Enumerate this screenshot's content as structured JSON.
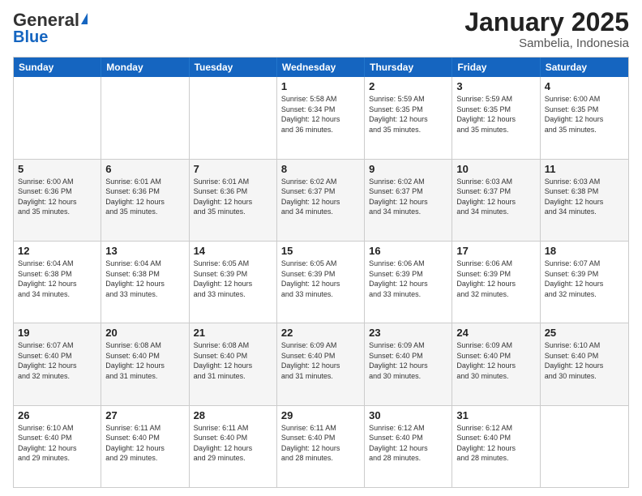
{
  "header": {
    "logo_general": "General",
    "logo_blue": "Blue",
    "month_title": "January 2025",
    "subtitle": "Sambelia, Indonesia"
  },
  "days_of_week": [
    "Sunday",
    "Monday",
    "Tuesday",
    "Wednesday",
    "Thursday",
    "Friday",
    "Saturday"
  ],
  "rows": [
    {
      "alt": false,
      "cells": [
        {
          "day": "",
          "info": ""
        },
        {
          "day": "",
          "info": ""
        },
        {
          "day": "",
          "info": ""
        },
        {
          "day": "1",
          "info": "Sunrise: 5:58 AM\nSunset: 6:34 PM\nDaylight: 12 hours\nand 36 minutes."
        },
        {
          "day": "2",
          "info": "Sunrise: 5:59 AM\nSunset: 6:35 PM\nDaylight: 12 hours\nand 35 minutes."
        },
        {
          "day": "3",
          "info": "Sunrise: 5:59 AM\nSunset: 6:35 PM\nDaylight: 12 hours\nand 35 minutes."
        },
        {
          "day": "4",
          "info": "Sunrise: 6:00 AM\nSunset: 6:35 PM\nDaylight: 12 hours\nand 35 minutes."
        }
      ]
    },
    {
      "alt": true,
      "cells": [
        {
          "day": "5",
          "info": "Sunrise: 6:00 AM\nSunset: 6:36 PM\nDaylight: 12 hours\nand 35 minutes."
        },
        {
          "day": "6",
          "info": "Sunrise: 6:01 AM\nSunset: 6:36 PM\nDaylight: 12 hours\nand 35 minutes."
        },
        {
          "day": "7",
          "info": "Sunrise: 6:01 AM\nSunset: 6:36 PM\nDaylight: 12 hours\nand 35 minutes."
        },
        {
          "day": "8",
          "info": "Sunrise: 6:02 AM\nSunset: 6:37 PM\nDaylight: 12 hours\nand 34 minutes."
        },
        {
          "day": "9",
          "info": "Sunrise: 6:02 AM\nSunset: 6:37 PM\nDaylight: 12 hours\nand 34 minutes."
        },
        {
          "day": "10",
          "info": "Sunrise: 6:03 AM\nSunset: 6:37 PM\nDaylight: 12 hours\nand 34 minutes."
        },
        {
          "day": "11",
          "info": "Sunrise: 6:03 AM\nSunset: 6:38 PM\nDaylight: 12 hours\nand 34 minutes."
        }
      ]
    },
    {
      "alt": false,
      "cells": [
        {
          "day": "12",
          "info": "Sunrise: 6:04 AM\nSunset: 6:38 PM\nDaylight: 12 hours\nand 34 minutes."
        },
        {
          "day": "13",
          "info": "Sunrise: 6:04 AM\nSunset: 6:38 PM\nDaylight: 12 hours\nand 33 minutes."
        },
        {
          "day": "14",
          "info": "Sunrise: 6:05 AM\nSunset: 6:39 PM\nDaylight: 12 hours\nand 33 minutes."
        },
        {
          "day": "15",
          "info": "Sunrise: 6:05 AM\nSunset: 6:39 PM\nDaylight: 12 hours\nand 33 minutes."
        },
        {
          "day": "16",
          "info": "Sunrise: 6:06 AM\nSunset: 6:39 PM\nDaylight: 12 hours\nand 33 minutes."
        },
        {
          "day": "17",
          "info": "Sunrise: 6:06 AM\nSunset: 6:39 PM\nDaylight: 12 hours\nand 32 minutes."
        },
        {
          "day": "18",
          "info": "Sunrise: 6:07 AM\nSunset: 6:39 PM\nDaylight: 12 hours\nand 32 minutes."
        }
      ]
    },
    {
      "alt": true,
      "cells": [
        {
          "day": "19",
          "info": "Sunrise: 6:07 AM\nSunset: 6:40 PM\nDaylight: 12 hours\nand 32 minutes."
        },
        {
          "day": "20",
          "info": "Sunrise: 6:08 AM\nSunset: 6:40 PM\nDaylight: 12 hours\nand 31 minutes."
        },
        {
          "day": "21",
          "info": "Sunrise: 6:08 AM\nSunset: 6:40 PM\nDaylight: 12 hours\nand 31 minutes."
        },
        {
          "day": "22",
          "info": "Sunrise: 6:09 AM\nSunset: 6:40 PM\nDaylight: 12 hours\nand 31 minutes."
        },
        {
          "day": "23",
          "info": "Sunrise: 6:09 AM\nSunset: 6:40 PM\nDaylight: 12 hours\nand 30 minutes."
        },
        {
          "day": "24",
          "info": "Sunrise: 6:09 AM\nSunset: 6:40 PM\nDaylight: 12 hours\nand 30 minutes."
        },
        {
          "day": "25",
          "info": "Sunrise: 6:10 AM\nSunset: 6:40 PM\nDaylight: 12 hours\nand 30 minutes."
        }
      ]
    },
    {
      "alt": false,
      "cells": [
        {
          "day": "26",
          "info": "Sunrise: 6:10 AM\nSunset: 6:40 PM\nDaylight: 12 hours\nand 29 minutes."
        },
        {
          "day": "27",
          "info": "Sunrise: 6:11 AM\nSunset: 6:40 PM\nDaylight: 12 hours\nand 29 minutes."
        },
        {
          "day": "28",
          "info": "Sunrise: 6:11 AM\nSunset: 6:40 PM\nDaylight: 12 hours\nand 29 minutes."
        },
        {
          "day": "29",
          "info": "Sunrise: 6:11 AM\nSunset: 6:40 PM\nDaylight: 12 hours\nand 28 minutes."
        },
        {
          "day": "30",
          "info": "Sunrise: 6:12 AM\nSunset: 6:40 PM\nDaylight: 12 hours\nand 28 minutes."
        },
        {
          "day": "31",
          "info": "Sunrise: 6:12 AM\nSunset: 6:40 PM\nDaylight: 12 hours\nand 28 minutes."
        },
        {
          "day": "",
          "info": ""
        }
      ]
    }
  ]
}
